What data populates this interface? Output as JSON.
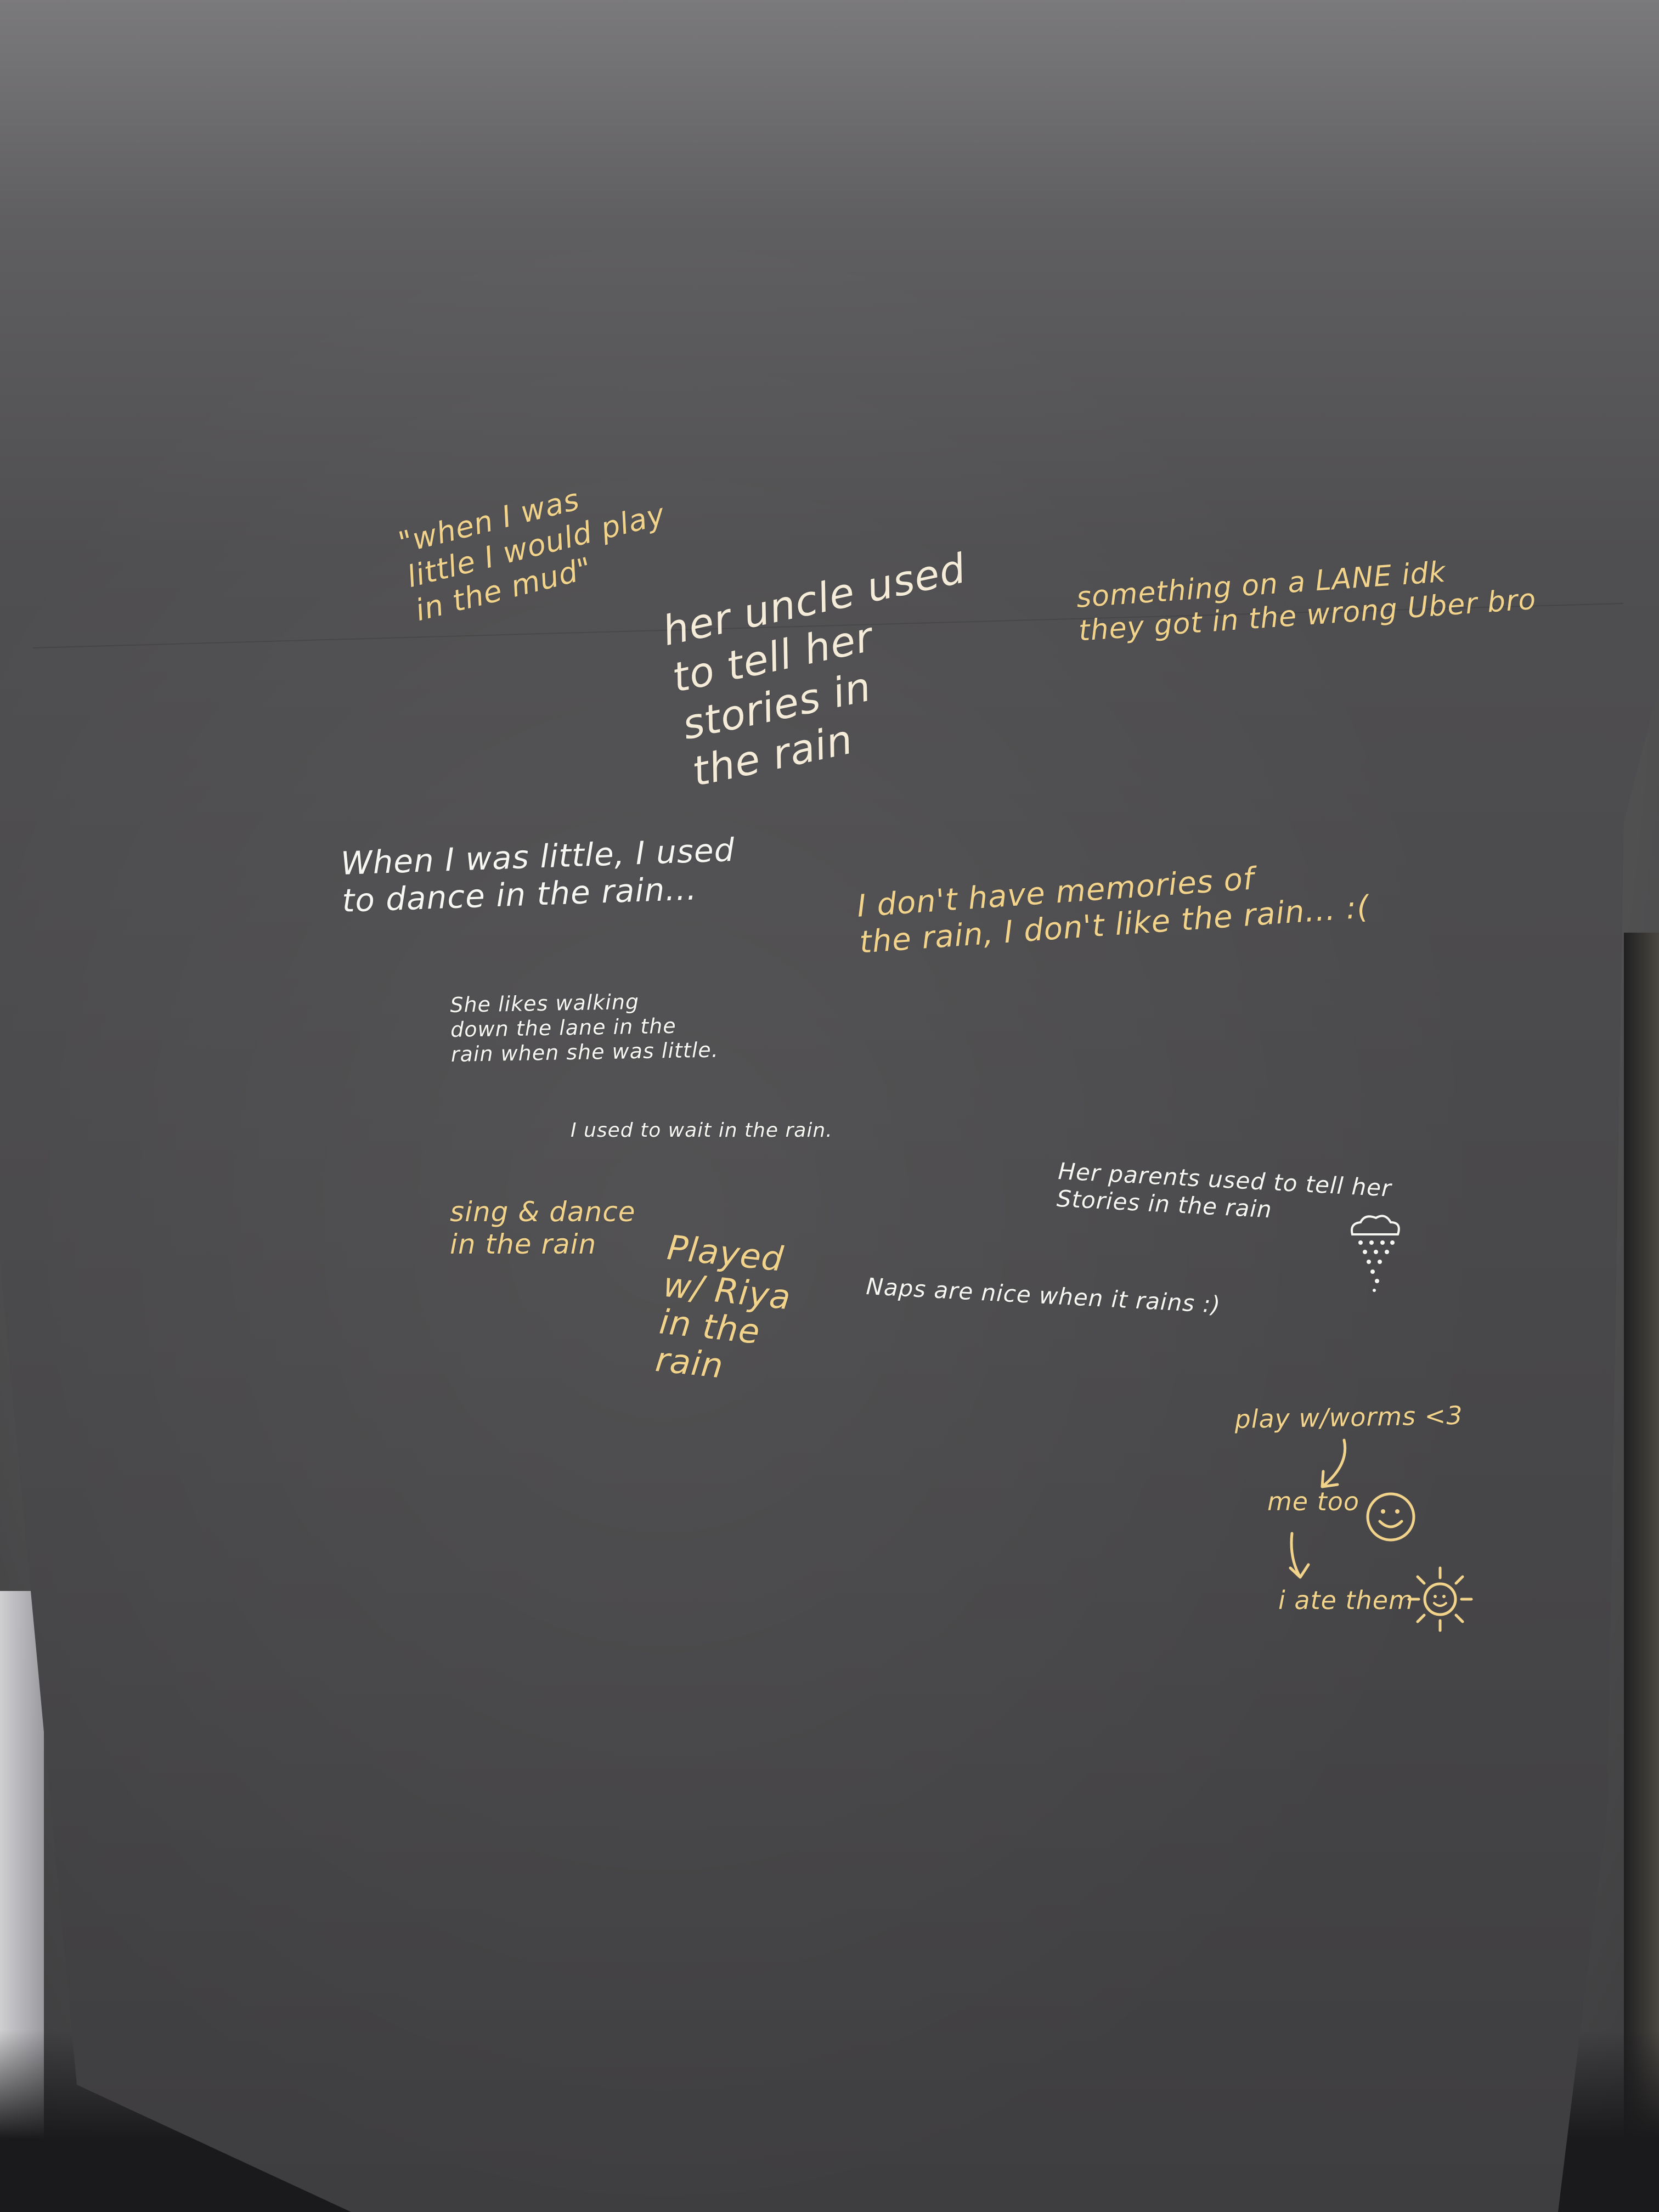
{
  "scene": {
    "board_color": "#4a494b",
    "ink_colors": {
      "gold": "#f1d38c",
      "cream": "#f4ecd9",
      "white": "#f6f6f2"
    }
  },
  "notes": [
    {
      "id": "mud",
      "text": "\"when I was\nlittle I would play\nin the mud\"",
      "ink": "gold"
    },
    {
      "id": "uncle",
      "text": "her uncle used\nto tell her\nstories in\nthe rain",
      "ink": "cream"
    },
    {
      "id": "lane",
      "text": "something on a LANE idk\nthey got in the wrong Uber bro",
      "ink": "gold"
    },
    {
      "id": "dance",
      "text": "When I was little, I used\nto dance in the rain...",
      "ink": "white"
    },
    {
      "id": "memories",
      "text": "I don't have memories of\nthe rain, I don't like the rain... :(",
      "ink": "gold"
    },
    {
      "id": "walking",
      "text": "She likes walking\ndown the lane in the\nrain when she was little.",
      "ink": "white"
    },
    {
      "id": "wait",
      "text": "I used to wait in the rain.",
      "ink": "white"
    },
    {
      "id": "parents",
      "text": "Her parents used to tell her\nStories in the rain",
      "ink": "white"
    },
    {
      "id": "sing",
      "text": "sing & dance\nin the rain",
      "ink": "gold"
    },
    {
      "id": "riya",
      "text": "Played\nw/ Riya\nin the\nrain",
      "ink": "gold"
    },
    {
      "id": "naps",
      "text": "Naps are nice when it rains :)",
      "ink": "white"
    },
    {
      "id": "worms",
      "text": "play w/worms <3",
      "ink": "gold"
    },
    {
      "id": "metoo",
      "text": "me too",
      "ink": "gold"
    },
    {
      "id": "ate",
      "text": "i ate them",
      "ink": "gold"
    }
  ],
  "doodles": {
    "rain_cloud": "rain-cloud-icon",
    "smiley": "smiley-face-icon",
    "sun": "sun-icon",
    "arrows": "arrow-icon"
  }
}
